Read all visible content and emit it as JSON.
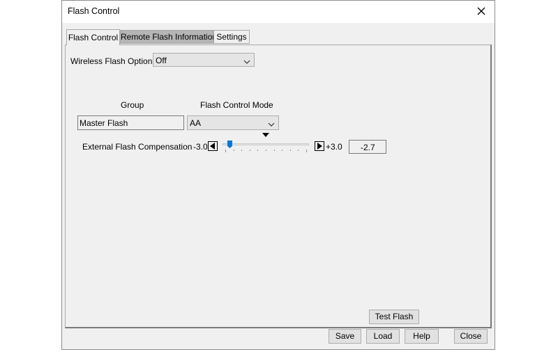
{
  "window": {
    "title": "Flash Control"
  },
  "tabs": [
    {
      "label": "Flash Control",
      "active": true
    },
    {
      "label": "Remote Flash Information",
      "active": false
    },
    {
      "label": "Settings",
      "active": false
    }
  ],
  "wireless": {
    "label": "Wireless Flash Options:",
    "value": "Off"
  },
  "table": {
    "group_header": "Group",
    "mode_header": "Flash Control Mode",
    "group_value": "Master Flash",
    "mode_value": "AA"
  },
  "compensation": {
    "label": "External Flash Compensation",
    "min_label": "-3.0",
    "max_label": "+3.0",
    "value_text": "-2.7",
    "min": -3.0,
    "max": 3.0,
    "value": -2.7,
    "marker_value": 0.0,
    "tick_count": 11
  },
  "buttons": {
    "test_flash": "Test Flash",
    "save": "Save",
    "load": "Load",
    "help": "Help",
    "close": "Close"
  },
  "icons": {
    "close": "close-x-icon",
    "dropdown": "chevron-down-icon",
    "left": "triangle-left-icon",
    "right": "triangle-right-icon",
    "marker": "triangle-down-icon"
  },
  "colors": {
    "window_bg": "#f0f0f0",
    "inactive_tab": "#b5b5b5",
    "slider_thumb": "#0078d7"
  }
}
